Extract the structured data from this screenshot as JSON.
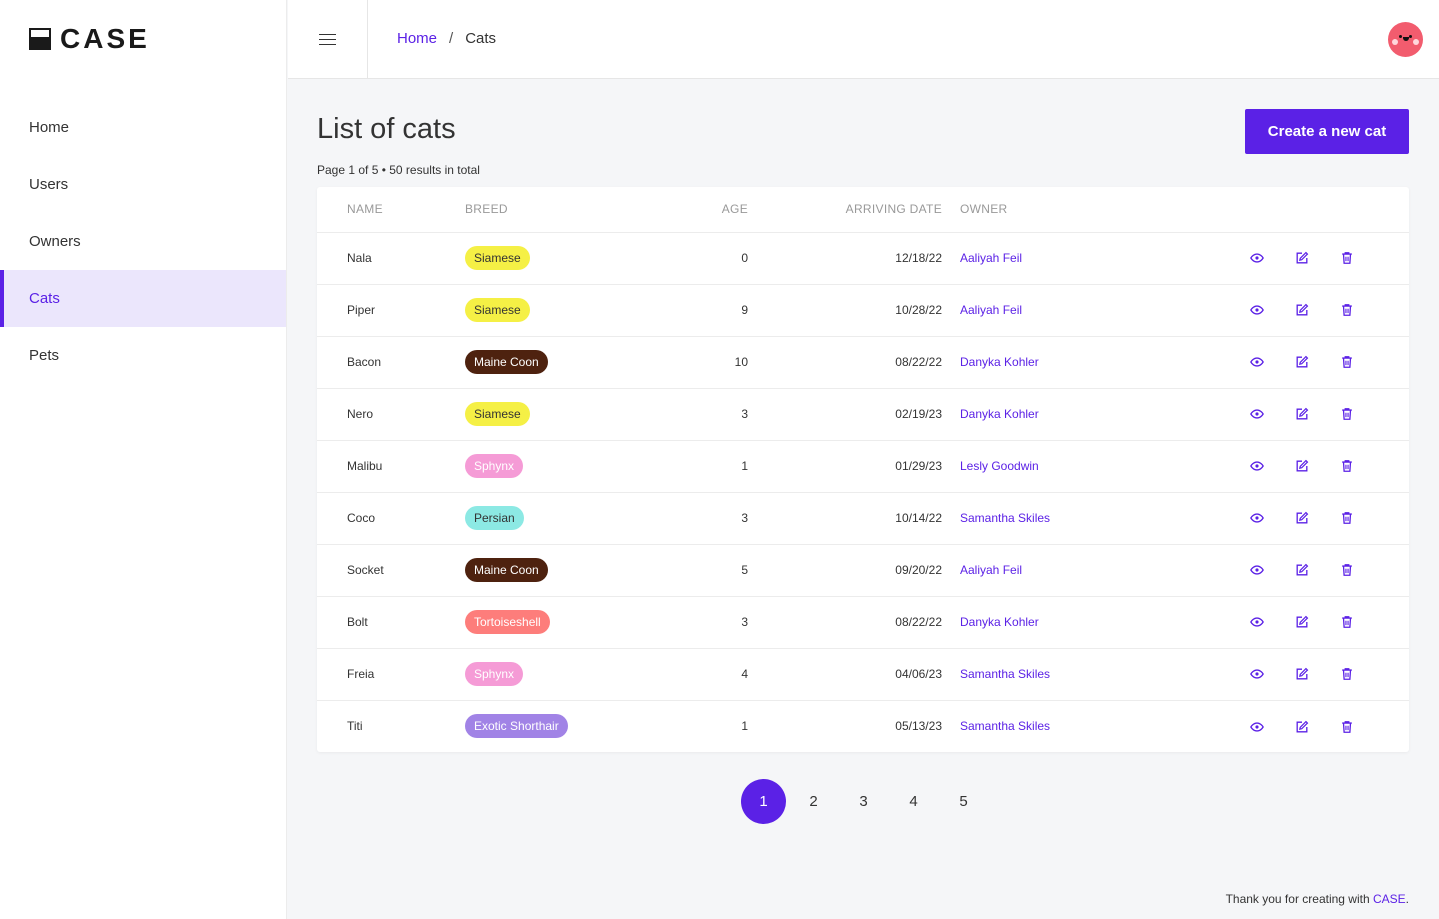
{
  "brand": {
    "name": "CASE",
    "accent": "#5b21e6"
  },
  "sidebar": {
    "items": [
      {
        "label": "Home",
        "active": false
      },
      {
        "label": "Users",
        "active": false
      },
      {
        "label": "Owners",
        "active": false
      },
      {
        "label": "Cats",
        "active": true
      },
      {
        "label": "Pets",
        "active": false
      }
    ]
  },
  "topbar": {
    "menu_icon": "hamburger-icon",
    "breadcrumb": {
      "home": "Home",
      "separator": "/",
      "current": "Cats"
    },
    "avatar_icon": "smiley-avatar"
  },
  "main": {
    "title": "List of cats",
    "create_button": "Create a new cat",
    "summary": "Page 1 of 5 • 50 results in total",
    "columns": [
      "NAME",
      "BREED",
      "AGE",
      "ARRIVING DATE",
      "OWNER"
    ],
    "action_icons": [
      "eye-icon",
      "edit-icon",
      "trash-icon"
    ],
    "rows": [
      {
        "name": "Nala",
        "breed": "Siamese",
        "breed_bg": "#f5f045",
        "breed_fg": "#333333",
        "age": "0",
        "date": "12/18/22",
        "owner": "Aaliyah Feil"
      },
      {
        "name": "Piper",
        "breed": "Siamese",
        "breed_bg": "#f5f045",
        "breed_fg": "#333333",
        "age": "9",
        "date": "10/28/22",
        "owner": "Aaliyah Feil"
      },
      {
        "name": "Bacon",
        "breed": "Maine Coon",
        "breed_bg": "#4e220f",
        "breed_fg": "#ffffff",
        "age": "10",
        "date": "08/22/22",
        "owner": "Danyka Kohler"
      },
      {
        "name": "Nero",
        "breed": "Siamese",
        "breed_bg": "#f5f045",
        "breed_fg": "#333333",
        "age": "3",
        "date": "02/19/23",
        "owner": "Danyka Kohler"
      },
      {
        "name": "Malibu",
        "breed": "Sphynx",
        "breed_bg": "#f59bd6",
        "breed_fg": "#ffffff",
        "age": "1",
        "date": "01/29/23",
        "owner": "Lesly Goodwin"
      },
      {
        "name": "Coco",
        "breed": "Persian",
        "breed_bg": "#8ce9e4",
        "breed_fg": "#333333",
        "age": "3",
        "date": "10/14/22",
        "owner": "Samantha Skiles"
      },
      {
        "name": "Socket",
        "breed": "Maine Coon",
        "breed_bg": "#4e220f",
        "breed_fg": "#ffffff",
        "age": "5",
        "date": "09/20/22",
        "owner": "Aaliyah Feil"
      },
      {
        "name": "Bolt",
        "breed": "Tortoiseshell",
        "breed_bg": "#fd7d7b",
        "breed_fg": "#ffffff",
        "age": "3",
        "date": "08/22/22",
        "owner": "Danyka Kohler"
      },
      {
        "name": "Freia",
        "breed": "Sphynx",
        "breed_bg": "#f59bd6",
        "breed_fg": "#ffffff",
        "age": "4",
        "date": "04/06/23",
        "owner": "Samantha Skiles"
      },
      {
        "name": "Titi",
        "breed": "Exotic Shorthair",
        "breed_bg": "#a183e6",
        "breed_fg": "#ffffff",
        "age": "1",
        "date": "05/13/23",
        "owner": "Samantha Skiles"
      }
    ]
  },
  "pagination": {
    "pages": [
      "1",
      "2",
      "3",
      "4",
      "5"
    ],
    "current": "1"
  },
  "footer": {
    "text": "Thank you for creating with ",
    "link": "CASE",
    "suffix": "."
  }
}
